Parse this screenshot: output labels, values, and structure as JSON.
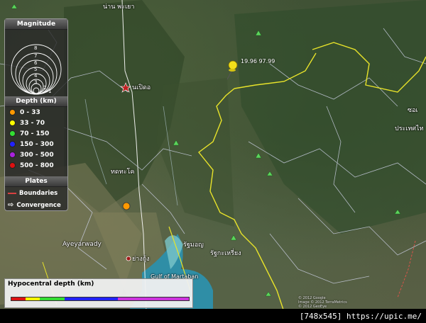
{
  "map": {
    "labels": {
      "top_city": "น่าน พะเยา",
      "city_1": "นเปิดอ",
      "city_2": "ทดทะโค",
      "city_3": "ย่างกุ้ง",
      "region_1": "Ayeyarwady",
      "region_2": "รัฐมอญ",
      "region_3": "รัฐกะเหรี่ยง",
      "gulf": "Gulf of Martaban",
      "right_1": "ซอเ",
      "right_2": "ประเทศไท",
      "copyright": "© 2012 Google\nImage © 2012 TerraMetrics\n© 2012 GeoEye"
    },
    "pin_label": "19.96 97.99"
  },
  "legend": {
    "magnitude_title": "Magnitude",
    "magnitude_values": [
      "8",
      "7",
      "6",
      "5",
      "4",
      "3",
      "2",
      "1"
    ],
    "depth_title": "Depth (km)",
    "depth_items": [
      {
        "label": "0 - 33",
        "color": "#ff9900"
      },
      {
        "label": "33 - 70",
        "color": "#ffff00"
      },
      {
        "label": "70 - 150",
        "color": "#33dd33"
      },
      {
        "label": "150 - 300",
        "color": "#2222ff"
      },
      {
        "label": "300 - 500",
        "color": "#aa22dd"
      },
      {
        "label": "500 - 800",
        "color": "#dd1111"
      }
    ],
    "plates_title": "Plates",
    "boundaries_label": "Boundaries",
    "convergence_label": "Convergence"
  },
  "depth_bar": {
    "title": "Hypocentral depth (km)"
  },
  "footer": "[748x545] https://upic.me/"
}
